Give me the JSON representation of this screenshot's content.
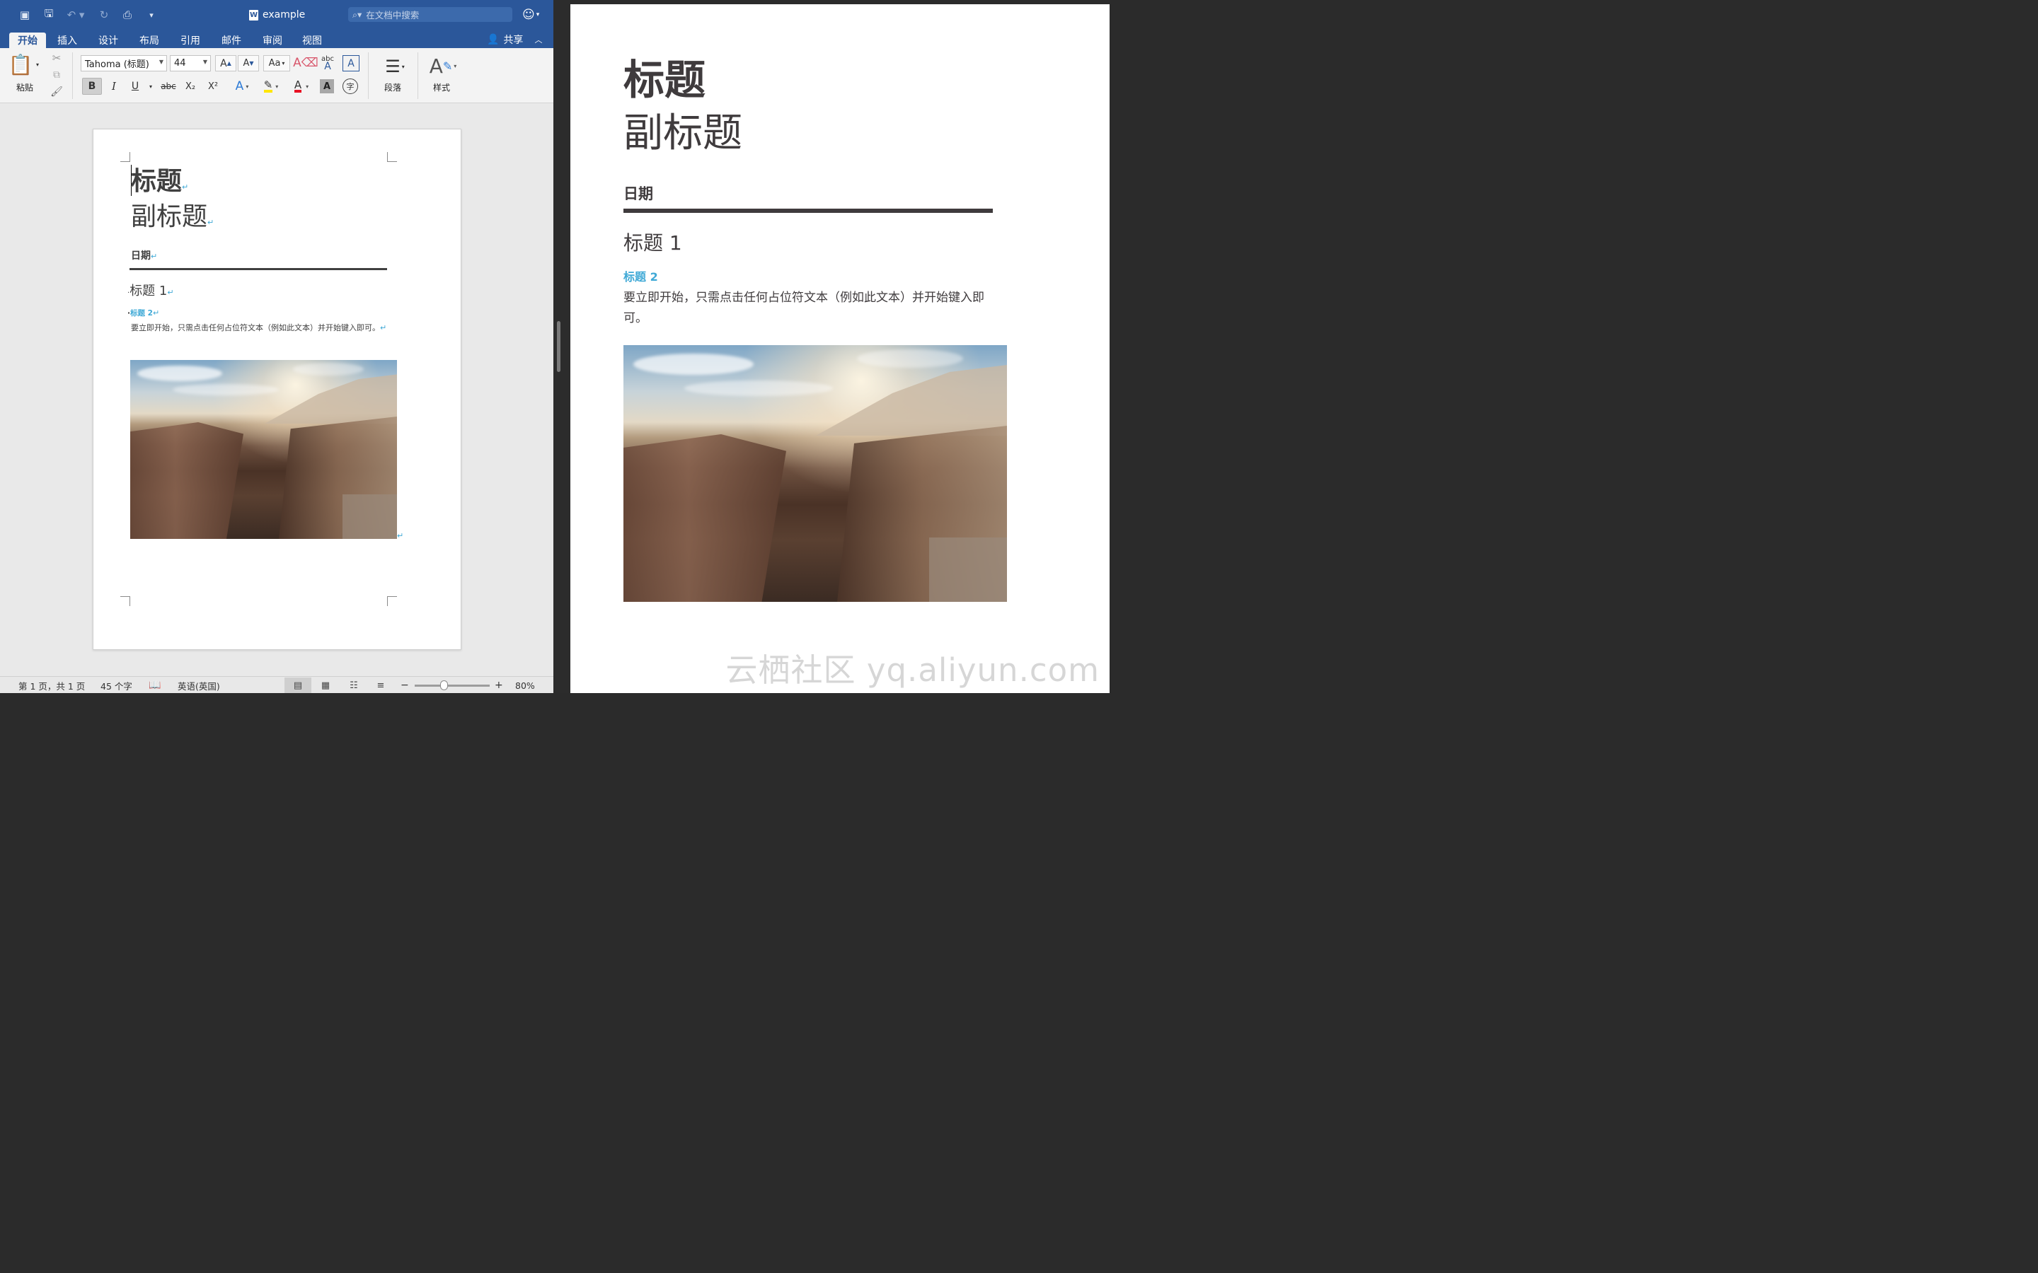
{
  "window": {
    "doc_name": "example",
    "search_placeholder": "在文档中搜索",
    "share_label": "共享"
  },
  "tabs": [
    {
      "label": "开始",
      "active": true
    },
    {
      "label": "插入"
    },
    {
      "label": "设计"
    },
    {
      "label": "布局"
    },
    {
      "label": "引用"
    },
    {
      "label": "邮件"
    },
    {
      "label": "审阅"
    },
    {
      "label": "视图"
    }
  ],
  "ribbon": {
    "paste_label": "粘贴",
    "font_name": "Tahoma (标题)",
    "font_size": "44",
    "bold": "B",
    "italic": "I",
    "underline": "U",
    "strike": "abc",
    "subscript": "X₂",
    "superscript": "X²",
    "paragraph_label": "段落",
    "styles_label": "样式"
  },
  "document": {
    "title": "标题",
    "subtitle": "副标题",
    "date": "日期",
    "heading1": "标题 1",
    "heading2": "标题 2",
    "body": "要立即开始，只需点击任何占位符文本（例如此文本）并开始键入即可。"
  },
  "preview": {
    "title": "标题",
    "subtitle": "副标题",
    "date": "日期",
    "heading1": "标题 1",
    "heading2": "标题 2",
    "body": "要立即开始，只需点击任何占位符文本（例如此文本）并开始键入即可。",
    "watermark": "云栖社区 yq.aliyun.com"
  },
  "status": {
    "page": "第 1 页，共 1 页",
    "words": "45 个字",
    "language": "英语(英国)",
    "zoom": "80%"
  },
  "colors": {
    "word_blue": "#2b579a",
    "heading2_blue": "#3fa9d6",
    "text_dark": "#404040"
  }
}
